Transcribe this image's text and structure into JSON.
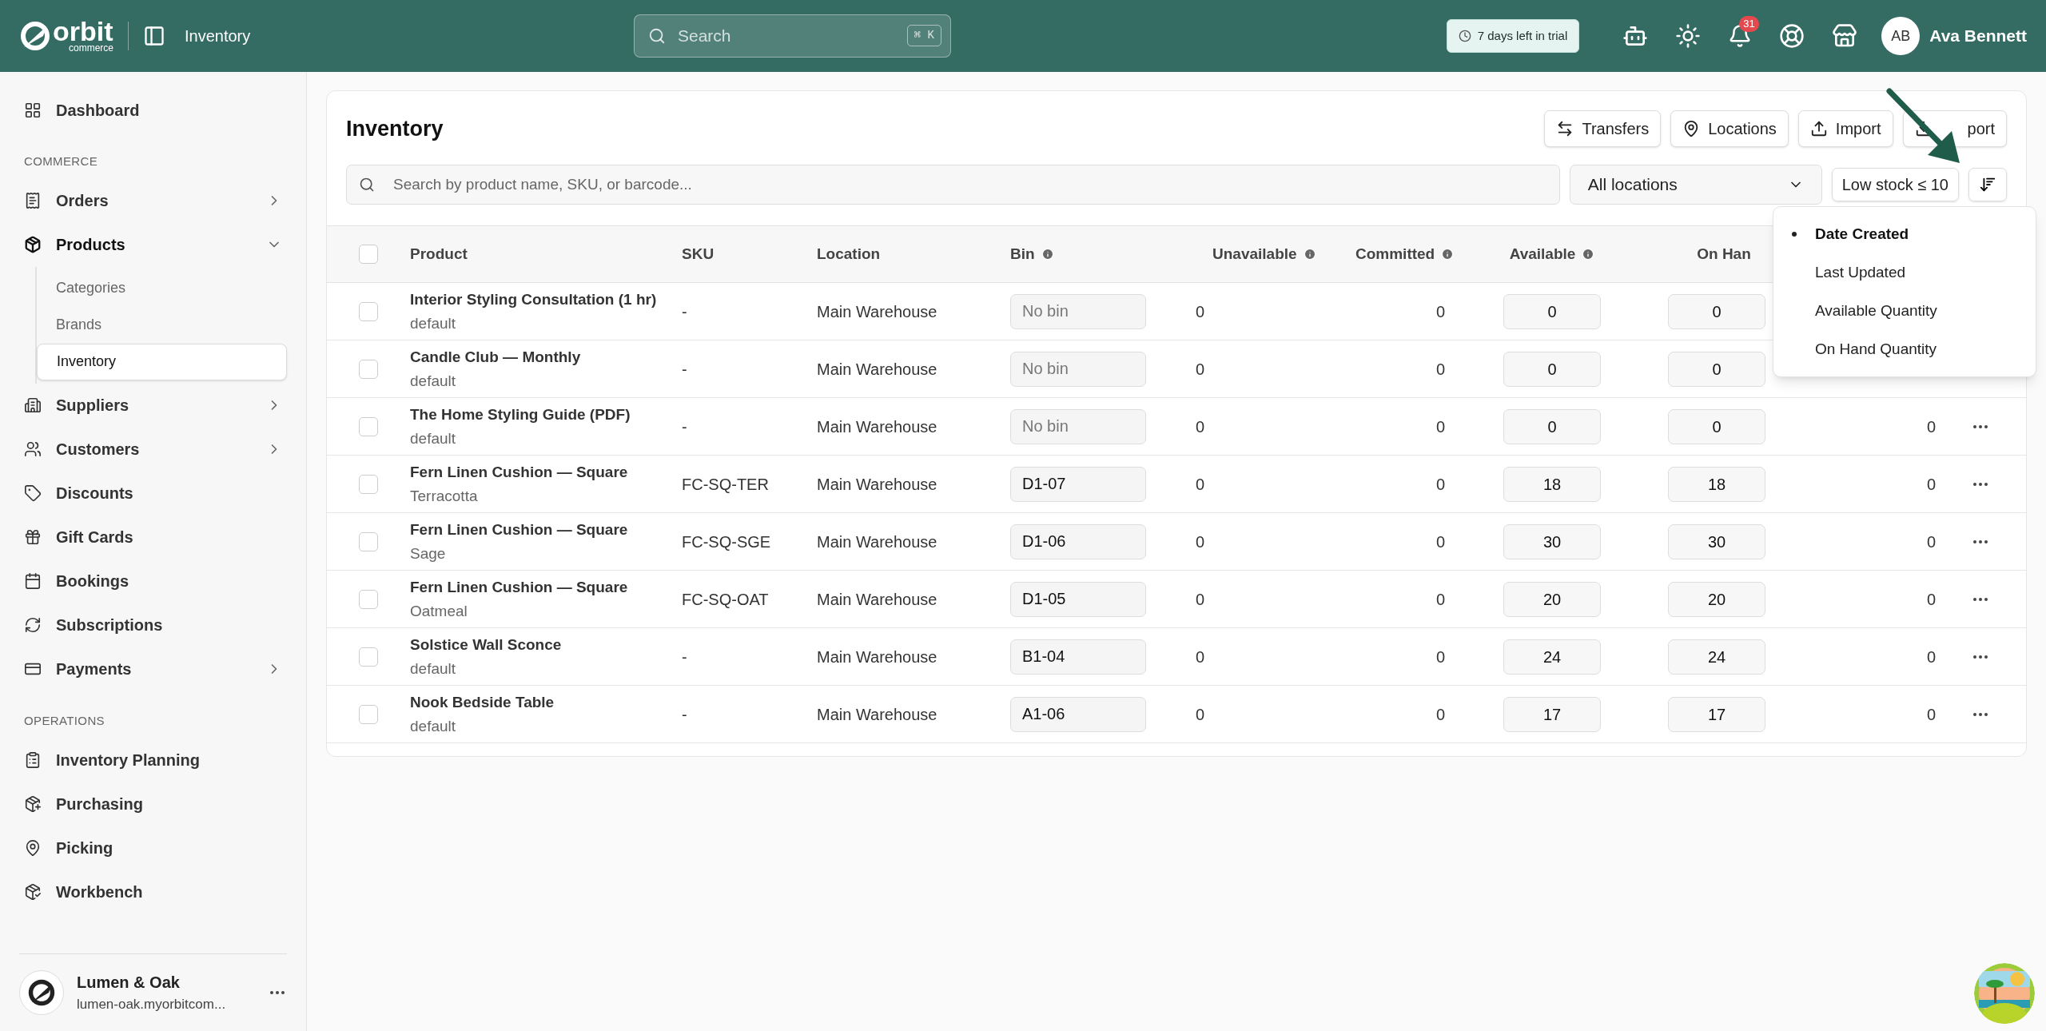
{
  "topbar": {
    "brand": "orbit",
    "brand_sub": "commerce",
    "page": "Inventory",
    "search": {
      "placeholder": "Search",
      "shortcut": "⌘ K"
    },
    "trial": "7 days left in trial",
    "notifications": "31",
    "user": {
      "initials": "AB",
      "name": "Ava Bennett"
    }
  },
  "sidebar": {
    "groups": [
      {
        "items": [
          {
            "label": "Dashboard",
            "selected": false
          }
        ]
      },
      {
        "heading": "COMMERCE",
        "items": [
          {
            "label": "Orders",
            "selected": false,
            "expanded": false
          },
          {
            "label": "Products",
            "selected": false,
            "expanded": true,
            "children": [
              {
                "label": "Categories",
                "selected": false
              },
              {
                "label": "Brands",
                "selected": false
              },
              {
                "label": "Inventory",
                "selected": true
              }
            ]
          },
          {
            "label": "Suppliers",
            "selected": false,
            "expanded": false
          },
          {
            "label": "Customers",
            "selected": false,
            "expanded": false
          },
          {
            "label": "Discounts",
            "selected": false
          },
          {
            "label": "Gift Cards",
            "selected": false
          },
          {
            "label": "Bookings",
            "selected": false
          },
          {
            "label": "Subscriptions",
            "selected": false
          },
          {
            "label": "Payments",
            "selected": false,
            "expanded": false
          }
        ]
      },
      {
        "heading": "OPERATIONS",
        "items": [
          {
            "label": "Inventory Planning",
            "selected": false
          },
          {
            "label": "Purchasing",
            "selected": false
          },
          {
            "label": "Picking",
            "selected": false
          },
          {
            "label": "Workbench",
            "selected": false
          }
        ]
      }
    ],
    "store": {
      "name": "Lumen & Oak",
      "domain": "lumen-oak.myorbitcom..."
    }
  },
  "main": {
    "title": "Inventory",
    "actions": [
      "Transfers",
      "Locations",
      "Import",
      "port"
    ],
    "search": {
      "placeholder": "Search by product name, SKU, or barcode..."
    },
    "location_select": "All locations",
    "filter": "Low stock ≤ 10",
    "sort_menu": {
      "open": true,
      "options": [
        {
          "label": "Date Created",
          "selected": true
        },
        {
          "label": "Last Updated",
          "selected": false
        },
        {
          "label": "Available Quantity",
          "selected": false
        },
        {
          "label": "On Hand Quantity",
          "selected": false
        }
      ]
    },
    "table": {
      "all_checked": false,
      "columns": [
        {
          "label": "Product",
          "info": false
        },
        {
          "label": "SKU",
          "info": false
        },
        {
          "label": "Location",
          "info": false
        },
        {
          "label": "Bin",
          "info": true
        },
        {
          "label": "Unavailable",
          "info": true
        },
        {
          "label": "Committed",
          "info": true
        },
        {
          "label": "Available",
          "info": true
        },
        {
          "label": "On Han",
          "info": false
        }
      ],
      "rows": [
        {
          "checked": false,
          "product": "Interior Styling Consultation (1 hr)",
          "variant": "default",
          "sku": "-",
          "location": "Main Warehouse",
          "bin_placeholder": "No bin",
          "unavailable": "0",
          "committed": "0",
          "available": "0",
          "on_hand": "0"
        },
        {
          "checked": false,
          "product": "Candle Club — Monthly",
          "variant": "default",
          "sku": "-",
          "location": "Main Warehouse",
          "bin_placeholder": "No bin",
          "unavailable": "0",
          "committed": "0",
          "available": "0",
          "on_hand": "0"
        },
        {
          "checked": false,
          "product": "The Home Styling Guide (PDF)",
          "variant": "default",
          "sku": "-",
          "location": "Main Warehouse",
          "bin_placeholder": "No bin",
          "unavailable": "0",
          "committed": "0",
          "available": "0",
          "on_hand": "0",
          "column_10": "0"
        },
        {
          "checked": false,
          "product": "Fern Linen Cushion — Square",
          "variant": "Terracotta",
          "sku": "FC-SQ-TER",
          "location": "Main Warehouse",
          "bin": "D1-07",
          "unavailable": "0",
          "committed": "0",
          "available": "18",
          "on_hand": "18",
          "column_10": "0"
        },
        {
          "checked": false,
          "product": "Fern Linen Cushion — Square",
          "variant": "Sage",
          "sku": "FC-SQ-SGE",
          "location": "Main Warehouse",
          "bin": "D1-06",
          "unavailable": "0",
          "committed": "0",
          "available": "30",
          "on_hand": "30",
          "column_10": "0"
        },
        {
          "checked": false,
          "product": "Fern Linen Cushion — Square",
          "variant": "Oatmeal",
          "sku": "FC-SQ-OAT",
          "location": "Main Warehouse",
          "bin": "D1-05",
          "unavailable": "0",
          "committed": "0",
          "available": "20",
          "on_hand": "20",
          "column_10": "0"
        },
        {
          "checked": false,
          "product": "Solstice Wall Sconce",
          "variant": "default",
          "sku": "-",
          "location": "Main Warehouse",
          "bin": "B1-04",
          "unavailable": "0",
          "committed": "0",
          "available": "24",
          "on_hand": "24",
          "column_10": "0"
        },
        {
          "checked": false,
          "product": "Nook Bedside Table",
          "variant": "default",
          "sku": "-",
          "location": "Main Warehouse",
          "bin": "A1-06",
          "unavailable": "0",
          "committed": "0",
          "available": "17",
          "on_hand": "17",
          "column_10": "0"
        }
      ]
    }
  }
}
